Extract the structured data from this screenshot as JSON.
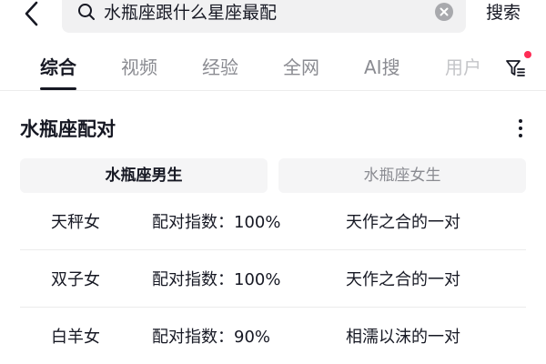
{
  "search": {
    "query": "水瓶座跟什么星座最配",
    "button_label": "搜索"
  },
  "tabs": [
    {
      "label": "综合",
      "active": true
    },
    {
      "label": "视频",
      "active": false
    },
    {
      "label": "经验",
      "active": false
    },
    {
      "label": "全网",
      "active": false
    },
    {
      "label": "AI搜",
      "active": false
    },
    {
      "label": "用户",
      "active": false
    }
  ],
  "icons": {
    "back": "chevron-left-icon",
    "search": "search-icon",
    "clear": "clear-icon",
    "filter": "filter-icon",
    "more": "more-vertical-icon"
  },
  "colors": {
    "accent_dot": "#fe2c55",
    "text_primary": "#161823",
    "text_secondary": "#8a8b91",
    "segment_bg": "#f5f5f6"
  },
  "card": {
    "title": "水瓶座配对",
    "segments": [
      {
        "label": "水瓶座男生",
        "selected": true
      },
      {
        "label": "水瓶座女生",
        "selected": false
      }
    ],
    "rows": [
      {
        "sign": "天秤女",
        "index_label": "配对指数：",
        "index_value": "100%",
        "desc": "天作之合的一对"
      },
      {
        "sign": "双子女",
        "index_label": "配对指数：",
        "index_value": "100%",
        "desc": "天作之合的一对"
      },
      {
        "sign": "白羊女",
        "index_label": "配对指数：",
        "index_value": "90%",
        "desc": "相濡以沫的一对"
      }
    ]
  }
}
